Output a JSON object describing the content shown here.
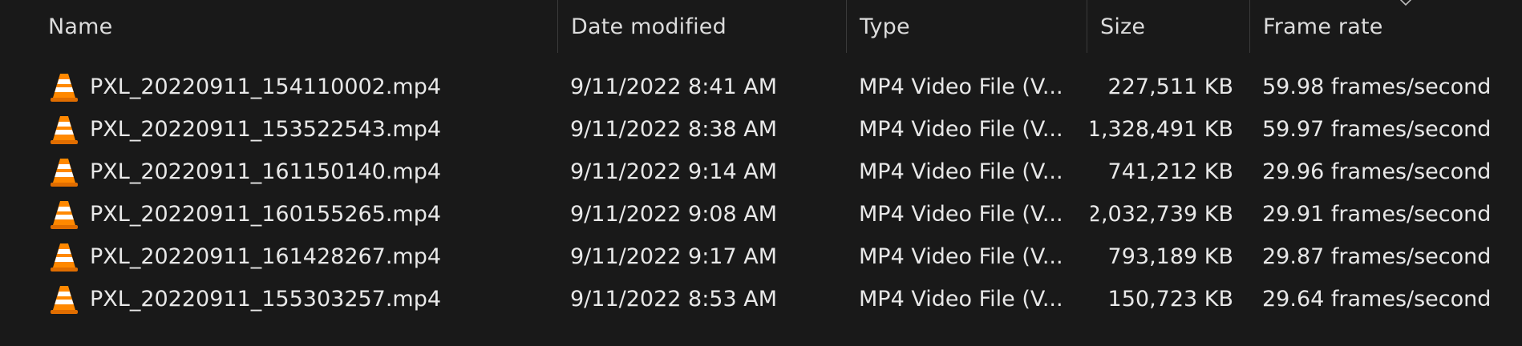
{
  "columns": {
    "name": "Name",
    "date_modified": "Date modified",
    "type": "Type",
    "size": "Size",
    "frame_rate": "Frame rate"
  },
  "sort": {
    "column": "frame_rate",
    "direction": "descending",
    "icon": "chevron-down-icon"
  },
  "file_icon": "vlc-cone-icon",
  "files": [
    {
      "name": "PXL_20220911_154110002.mp4",
      "date": "9/11/2022 8:41 AM",
      "type": "MP4 Video File (V...",
      "size": "227,511 KB",
      "frame_rate": "59.98 frames/second"
    },
    {
      "name": "PXL_20220911_153522543.mp4",
      "date": "9/11/2022 8:38 AM",
      "type": "MP4 Video File (V...",
      "size": "1,328,491 KB",
      "frame_rate": "59.97 frames/second"
    },
    {
      "name": "PXL_20220911_161150140.mp4",
      "date": "9/11/2022 9:14 AM",
      "type": "MP4 Video File (V...",
      "size": "741,212 KB",
      "frame_rate": "29.96 frames/second"
    },
    {
      "name": "PXL_20220911_160155265.mp4",
      "date": "9/11/2022 9:08 AM",
      "type": "MP4 Video File (V...",
      "size": "2,032,739 KB",
      "frame_rate": "29.91 frames/second"
    },
    {
      "name": "PXL_20220911_161428267.mp4",
      "date": "9/11/2022 9:17 AM",
      "type": "MP4 Video File (V...",
      "size": "793,189 KB",
      "frame_rate": "29.87 frames/second"
    },
    {
      "name": "PXL_20220911_155303257.mp4",
      "date": "9/11/2022 8:53 AM",
      "type": "MP4 Video File (V...",
      "size": "150,723 KB",
      "frame_rate": "29.64 frames/second"
    }
  ]
}
